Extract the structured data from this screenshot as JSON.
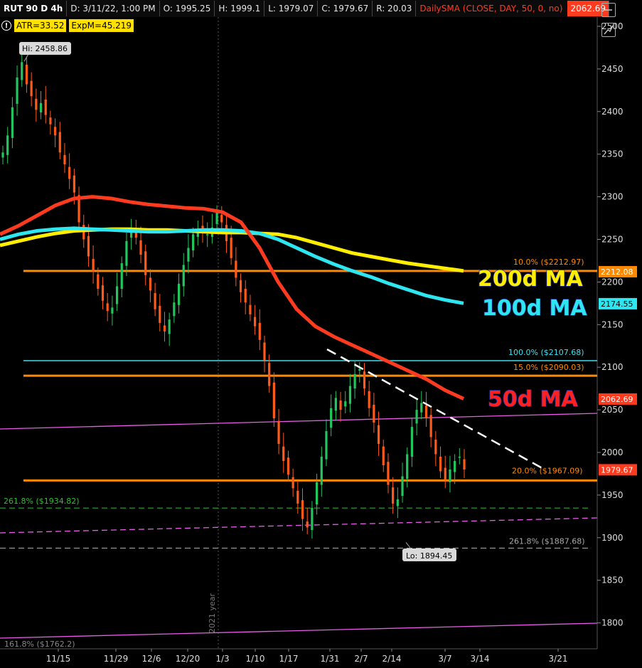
{
  "header": {
    "symbol": "RUT 90 D 4h",
    "date": "D: 3/11/22, 1:00 PM",
    "open": "O: 1995.25",
    "high": "H: 1999.1",
    "low": "L: 1979.07",
    "close": "C: 1979.67",
    "range": "R: 20.03",
    "study": "DailySMA (CLOSE, DAY, 50, 0, no)",
    "study_value": "2062.69"
  },
  "badges": {
    "atr": "ATR=33.52",
    "expm": "ExpM=45.219"
  },
  "icons": {
    "alert": "alert-icon",
    "zoom_out": "zoom-out-icon",
    "trend": "trend-icon"
  },
  "colors": {
    "background": "#000000",
    "up_candle": "#22c55e",
    "down_candle": "#ff5a1a",
    "ma50": "#ff3b1f",
    "ma100": "#2ee6f0",
    "ma200": "#ffee00",
    "orange_level": "#ff8a00",
    "cyan_level": "#40e0f0",
    "magenta_channel": "#e85ce8",
    "green_fib": "#2dbf2d",
    "trendline": "#ffffff"
  },
  "chart_data": {
    "type": "candlestick",
    "ylim": [
      1740,
      2520
    ],
    "y_ticks": [
      2500,
      2450,
      2400,
      2350,
      2300,
      2250,
      2200,
      2150,
      2100,
      2050,
      2000,
      1950,
      1900,
      1850,
      1800
    ],
    "x_ticks": [
      "11/15",
      "11/29",
      "12/6",
      "12/20",
      "1/3",
      "1/10",
      "1/17",
      "1/31",
      "2/7",
      "2/14",
      "3/7",
      "3/14",
      "3/21"
    ],
    "year_marker": "2021 year",
    "candle_closes": [
      2352,
      2372,
      2405,
      2440,
      2458,
      2432,
      2418,
      2402,
      2410,
      2396,
      2385,
      2372,
      2352,
      2338,
      2321,
      2305,
      2270,
      2250,
      2230,
      2212,
      2192,
      2178,
      2166,
      2170,
      2195,
      2222,
      2248,
      2262,
      2252,
      2232,
      2208,
      2190,
      2168,
      2152,
      2142,
      2156,
      2176,
      2198,
      2220,
      2240,
      2256,
      2262,
      2258,
      2256,
      2264,
      2282,
      2270,
      2248,
      2228,
      2205,
      2188,
      2176,
      2162,
      2148,
      2132,
      2108,
      2078,
      2040,
      2010,
      1990,
      1974,
      1958,
      1940,
      1922,
      1912,
      1935,
      1965,
      1995,
      2025,
      2052,
      2064,
      2050,
      2060,
      2078,
      2092,
      2098,
      2075,
      2052,
      2035,
      2010,
      1985,
      1962,
      1940,
      1945,
      1972,
      1998,
      2030,
      2050,
      2058,
      2040,
      2018,
      1998,
      1978,
      1968,
      1980,
      1990,
      1995,
      1980
    ],
    "price_labels": [
      {
        "text": "2212.08",
        "value": 2212.08,
        "color": "#ff8a00"
      },
      {
        "text": "2174.55",
        "value": 2174.55,
        "color": "#2ee6f0"
      },
      {
        "text": "2062.69",
        "value": 2062.69,
        "color": "#ff3b1f"
      },
      {
        "text": "1979.67",
        "value": 1979.67,
        "color": "#ff3b1f"
      }
    ],
    "hi_label": {
      "text": "Hi: 2458.86",
      "value": 2458.86
    },
    "lo_label": {
      "text": "Lo: 1894.45",
      "value": 1894.45
    },
    "levels": [
      {
        "value": 2212.97,
        "label": "10.0%  ($2212.97)",
        "color": "#ff8a00"
      },
      {
        "value": 2107.68,
        "label": "100.0%  ($2107.68)",
        "color": "#40e0f0"
      },
      {
        "value": 2090.03,
        "label": "15.0%  ($2090.03)",
        "color": "#ff8a00"
      },
      {
        "value": 1967.09,
        "label": "20.0%  ($1967.09)",
        "color": "#ff8a00"
      },
      {
        "value": 1934.82,
        "label": "261.8%  ($1934.82)",
        "color": "#2dbf2d"
      },
      {
        "value": 1887.68,
        "label": "261.8%  ($1887.68)",
        "color": "#aaaaaa"
      },
      {
        "value": 1762.2,
        "label": "161.8%  ($1762.2)",
        "color": "#888888"
      }
    ],
    "moving_averages": [
      {
        "name": "200d MA",
        "color": "#ffee00",
        "values": [
          2243,
          2248,
          2253,
          2257,
          2260,
          2261,
          2262,
          2262,
          2261,
          2261,
          2260,
          2259,
          2258,
          2258,
          2257,
          2256,
          2252,
          2246,
          2240,
          2234,
          2230,
          2226,
          2222,
          2219,
          2216,
          2213
        ]
      },
      {
        "name": "100d MA",
        "color": "#2ee6f0",
        "values": [
          2250,
          2256,
          2260,
          2262,
          2263,
          2262,
          2261,
          2260,
          2259,
          2259,
          2260,
          2261,
          2261,
          2260,
          2257,
          2250,
          2240,
          2230,
          2221,
          2213,
          2206,
          2198,
          2191,
          2184,
          2179,
          2175
        ]
      },
      {
        "name": "50d MA",
        "color": "#ff3b1f",
        "values": [
          2256,
          2266,
          2278,
          2290,
          2298,
          2300,
          2298,
          2294,
          2291,
          2289,
          2287,
          2286,
          2282,
          2270,
          2240,
          2200,
          2168,
          2148,
          2136,
          2126,
          2116,
          2106,
          2096,
          2086,
          2073,
          2063
        ]
      }
    ]
  }
}
